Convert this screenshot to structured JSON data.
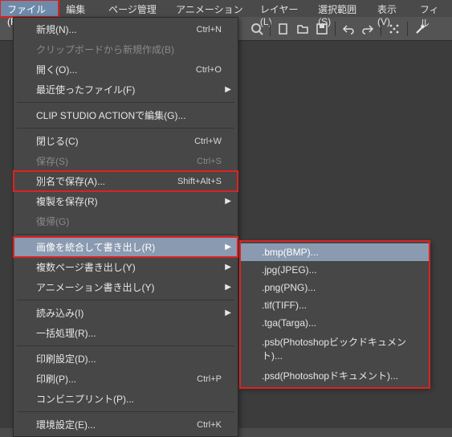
{
  "menubar": {
    "file": "ファイル(F)",
    "edit": "編集(E)",
    "page": "ページ管理(P)",
    "anim": "アニメーション(A)",
    "layer": "レイヤー(L)",
    "select": "選択範囲(S)",
    "view": "表示(V)",
    "filter": "フィル"
  },
  "file_menu": {
    "new": {
      "label": "新規(N)...",
      "shortcut": "Ctrl+N"
    },
    "newclip": {
      "label": "クリップボードから新規作成(B)"
    },
    "open": {
      "label": "開く(O)...",
      "shortcut": "Ctrl+O"
    },
    "recent": {
      "label": "最近使ったファイル(F)"
    },
    "csaction": {
      "label": "CLIP STUDIO ACTIONで編集(G)..."
    },
    "close": {
      "label": "閉じる(C)",
      "shortcut": "Ctrl+W"
    },
    "save": {
      "label": "保存(S)",
      "shortcut": "Ctrl+S"
    },
    "saveas": {
      "label": "別名で保存(A)...",
      "shortcut": "Shift+Alt+S"
    },
    "savecopy": {
      "label": "複製を保存(R)"
    },
    "revert": {
      "label": "復帰(G)"
    },
    "flatten_export": {
      "label": "画像を統合して書き出し(R)"
    },
    "multipage_export": {
      "label": "複数ページ書き出し(Y)"
    },
    "anim_export": {
      "label": "アニメーション書き出し(Y)"
    },
    "import": {
      "label": "読み込み(I)"
    },
    "batch": {
      "label": "一括処理(R)..."
    },
    "print_setup": {
      "label": "印刷設定(D)..."
    },
    "print": {
      "label": "印刷(P)...",
      "shortcut": "Ctrl+P"
    },
    "convini": {
      "label": "コンビニプリント(P)..."
    },
    "prefs": {
      "label": "環境設定(E)...",
      "shortcut": "Ctrl+K"
    }
  },
  "export_submenu": {
    "bmp": ".bmp(BMP)...",
    "jpg": ".jpg(JPEG)...",
    "png": ".png(PNG)...",
    "tif": ".tif(TIFF)...",
    "tga": ".tga(Targa)...",
    "psb": ".psb(Photoshopビックドキュメント)...",
    "psd": ".psd(Photoshopドキュメント)..."
  }
}
